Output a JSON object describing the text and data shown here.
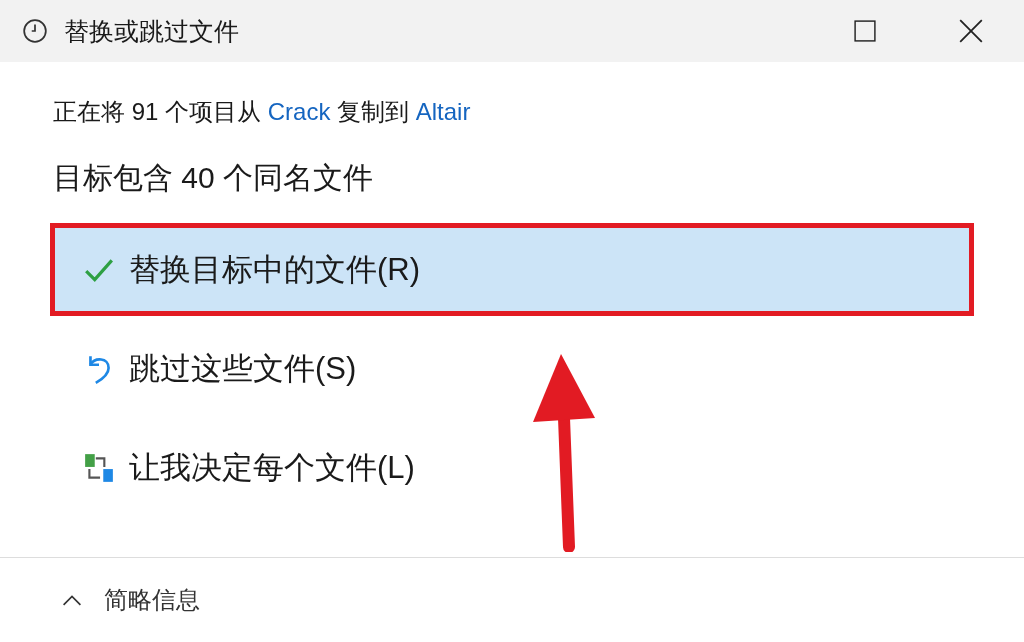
{
  "window": {
    "title": "替换或跳过文件"
  },
  "copy_line": {
    "prefix": "正在将 91 个项目从",
    "source": "Crack",
    "middle": "复制到",
    "destination": "Altair"
  },
  "heading": "目标包含 40 个同名文件",
  "options": [
    {
      "kind": "replace",
      "label": "替换目标中的文件(R)",
      "selected": true
    },
    {
      "kind": "skip",
      "label": "跳过这些文件(S)",
      "selected": false
    },
    {
      "kind": "decide",
      "label": "让我决定每个文件(L)",
      "selected": false
    }
  ],
  "footer": {
    "label": "简略信息"
  }
}
